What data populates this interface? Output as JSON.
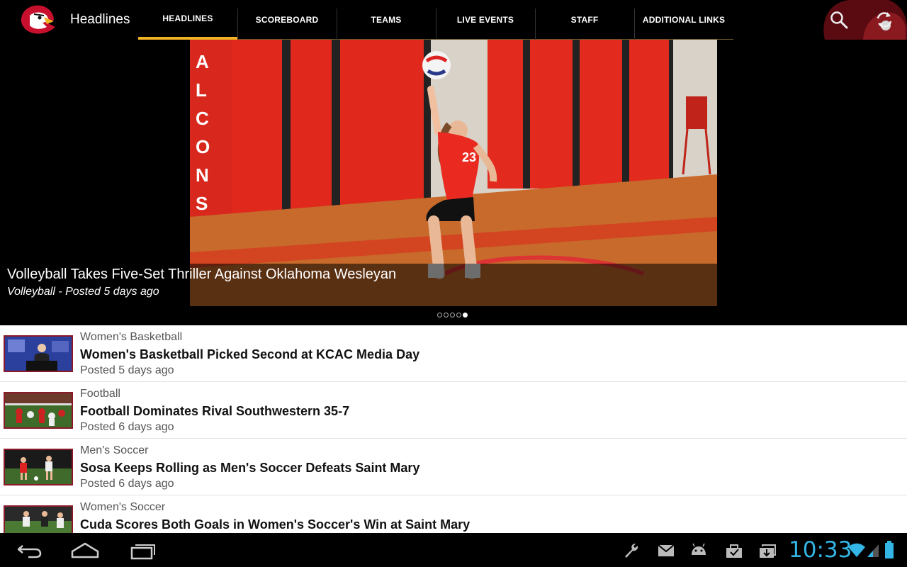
{
  "app": {
    "title": "Headlines",
    "accent_color": "#f0b323",
    "brand_color": "#c8102e"
  },
  "tabs": [
    {
      "label": "HEADLINES",
      "selected": true
    },
    {
      "label": "SCOREBOARD",
      "selected": false
    },
    {
      "label": "TEAMS",
      "selected": false
    },
    {
      "label": "LIVE EVENTS",
      "selected": false
    },
    {
      "label": "STAFF",
      "selected": false
    },
    {
      "label": "ADDITIONAL LINKS",
      "selected": false
    }
  ],
  "actions": {
    "search_icon": "search-icon",
    "refresh_icon": "refresh-icon"
  },
  "hero": {
    "title": "Volleyball Takes Five-Set Thriller Against Oklahoma Wesleyan",
    "meta": "Volleyball - Posted 5 days ago",
    "page_count": 5,
    "current_page": 5
  },
  "news": [
    {
      "category": "Women's Basketball",
      "headline": "Women's Basketball Picked Second at KCAC Media Day",
      "posted": "Posted 5 days ago"
    },
    {
      "category": "Football",
      "headline": "Football Dominates Rival Southwestern 35-7",
      "posted": "Posted 6 days ago"
    },
    {
      "category": "Men's Soccer",
      "headline": "Sosa Keeps Rolling as Men's Soccer Defeats Saint Mary",
      "posted": "Posted 6 days ago"
    },
    {
      "category": "Women's Soccer",
      "headline": "Cuda Scores Both Goals in Women's Soccer's Win at Saint Mary",
      "posted": ""
    }
  ],
  "system": {
    "clock": "10:33",
    "clock_color": "#33b5e5",
    "nav": [
      "back-icon",
      "home-icon",
      "recent-apps-icon"
    ],
    "notifications": [
      "wrench-icon",
      "mail-icon",
      "android-icon",
      "briefcase-check-icon",
      "download-icon"
    ],
    "status": [
      "wifi-icon",
      "signal-icon",
      "battery-icon"
    ]
  }
}
